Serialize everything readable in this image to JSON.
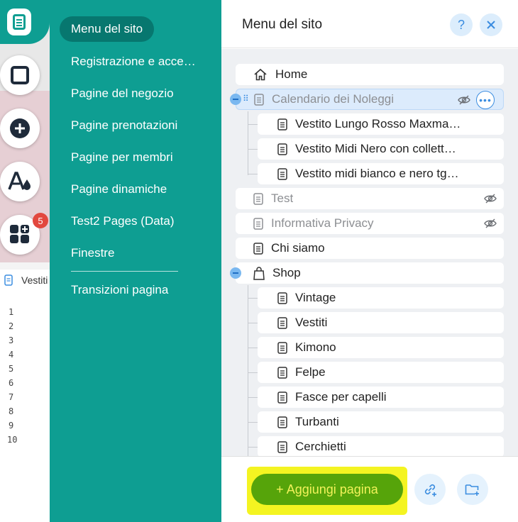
{
  "rail": {
    "badge_count": "5",
    "code_file": "Vestiti",
    "line_numbers": [
      "1",
      "2",
      "3",
      "4",
      "5",
      "6",
      "7",
      "8",
      "9",
      "10"
    ]
  },
  "categories": {
    "active": "Menu del sito",
    "items": [
      "Registrazione e acce…",
      "Pagine del negozio",
      "Pagine prenotazioni",
      "Pagine per membri",
      "Pagine dinamiche",
      "Test2 Pages (Data)",
      "Finestre"
    ],
    "transitions": "Transizioni pagina"
  },
  "pages_panel": {
    "title": "Menu del sito",
    "help_label": "?",
    "rows": [
      {
        "label": "Home",
        "icon": "home-icon"
      },
      {
        "label": "Calendario dei Noleggi",
        "icon": "page-icon",
        "hidden": true,
        "selected": true
      },
      {
        "label": "Vestito Lungo Rosso Maxma…",
        "icon": "page-icon"
      },
      {
        "label": "Vestito Midi Nero con collett…",
        "icon": "page-icon"
      },
      {
        "label": "Vestito midi bianco e nero tg…",
        "icon": "page-icon"
      },
      {
        "label": "Test",
        "icon": "page-icon",
        "hidden": true
      },
      {
        "label": "Informativa Privacy",
        "icon": "page-icon",
        "hidden": true
      },
      {
        "label": "Chi siamo",
        "icon": "page-icon"
      },
      {
        "label": "Shop",
        "icon": "shopping-bag-icon"
      },
      {
        "label": "Vintage",
        "icon": "page-icon"
      },
      {
        "label": "Vestiti",
        "icon": "page-icon"
      },
      {
        "label": "Kimono",
        "icon": "page-icon"
      },
      {
        "label": "Felpe",
        "icon": "page-icon"
      },
      {
        "label": "Fasce per capelli",
        "icon": "page-icon"
      },
      {
        "label": "Turbanti",
        "icon": "page-icon"
      },
      {
        "label": "Cerchietti",
        "icon": "page-icon"
      }
    ],
    "add_page_label": "+ Aggiungi pagina"
  },
  "colors": {
    "teal": "#0e9e92",
    "teal_dark": "#07776f",
    "accent_blue": "#3b8de0",
    "add_button_green": "#56a40a",
    "highlight_yellow": "#f4f421",
    "badge_red": "#e2483f"
  }
}
